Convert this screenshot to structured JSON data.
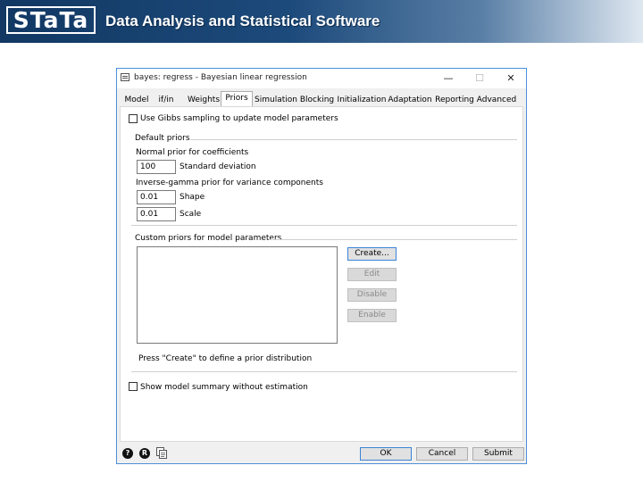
{
  "header": {
    "logo_text": "STaTa",
    "tagline": "Data Analysis and Statistical Software",
    "colors": {
      "banner_dark": "#123863",
      "banner_light": "#dfe8f1"
    }
  },
  "dialog": {
    "title": "bayes: regress - Bayesian linear regression",
    "window_controls": {
      "minimize": "—",
      "maximize": "☐",
      "close": "✕"
    },
    "tabs": [
      {
        "label": "Model"
      },
      {
        "label": "if/in"
      },
      {
        "label": "Weights"
      },
      {
        "label": "Priors",
        "active": true
      },
      {
        "label": "Simulation"
      },
      {
        "label": "Blocking"
      },
      {
        "label": "Initialization"
      },
      {
        "label": "Adaptation"
      },
      {
        "label": "Reporting"
      },
      {
        "label": "Advanced"
      }
    ],
    "gibbs_checkbox": {
      "label": "Use Gibbs sampling to update model parameters",
      "checked": false
    },
    "default_priors": {
      "group_title": "Default priors",
      "normal_label": "Normal prior for coefficients",
      "sd_value": "100",
      "sd_label": "Standard deviation",
      "invgamma_label": "Inverse-gamma prior for variance components",
      "shape_value": "0.01",
      "shape_label": "Shape",
      "scale_value": "0.01",
      "scale_label": "Scale"
    },
    "custom_priors": {
      "group_title": "Custom priors for model parameters",
      "buttons": {
        "create": "Create...",
        "edit": "Edit",
        "disable": "Disable",
        "enable": "Enable"
      },
      "hint": "Press \"Create\" to define a prior distribution"
    },
    "summary_checkbox": {
      "label": "Show model summary without estimation",
      "checked": false
    },
    "footer": {
      "help_icon": "?",
      "reset_icon": "R",
      "ok": "OK",
      "cancel": "Cancel",
      "submit": "Submit"
    },
    "colors": {
      "focus_border": "#4a90d9",
      "window_bg": "#f0f0f0"
    }
  }
}
